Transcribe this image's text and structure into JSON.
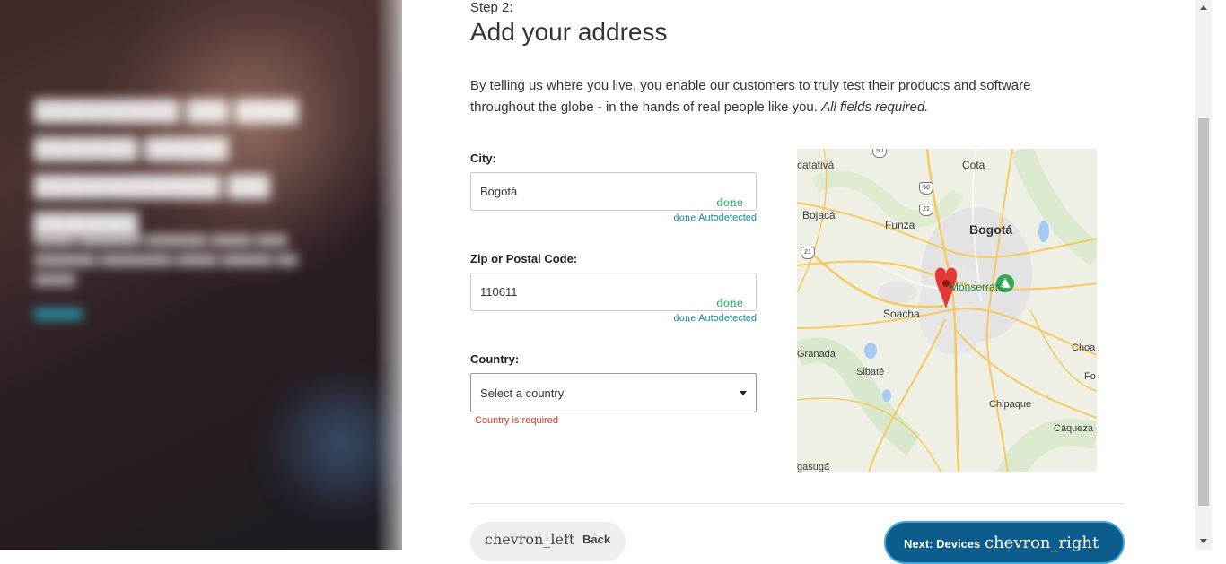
{
  "hero": {
    "blurred": true
  },
  "step": {
    "label": "Step 2:",
    "title": "Add your address"
  },
  "intro": {
    "text": "By telling us where you live, you enable our customers to truly test their products and software throughout the globe - in the hands of real people like you. ",
    "emphasis": "All fields required."
  },
  "form": {
    "city": {
      "label": "City:",
      "value": "Bogotá",
      "status_icon": "done",
      "autodetected_icon": "done",
      "autodetected": "Autodetected"
    },
    "zip": {
      "label": "Zip or Postal Code:",
      "value": "110611",
      "status_icon": "done",
      "autodetected_icon": "done",
      "autodetected": "Autodetected"
    },
    "country": {
      "label": "Country:",
      "placeholder": "Select a country",
      "error": "Country is required"
    }
  },
  "map": {
    "labels": {
      "catativa": "catativá",
      "cota": "Cota",
      "bojaca": "Bojacá",
      "funza": "Funza",
      "bogota": "Bogotá",
      "monserrate": "Monserrate",
      "soacha": "Soacha",
      "granada": "Granada",
      "sibate": "Sibaté",
      "choa": "Choa",
      "fo": "Fo",
      "chipaque": "Chipaque",
      "caqueza": "Cáqueza",
      "fusagasuga": "gasugá"
    },
    "shields": {
      "r50a": "50",
      "r50b": "50",
      "r21a": "21",
      "r21b": "21"
    }
  },
  "nav": {
    "back_icon": "chevron_left",
    "back_label": "Back",
    "next_label": "Next: Devices",
    "next_icon": "chevron_right"
  },
  "colors": {
    "accent": "#0c5c8e",
    "success": "#12b05a",
    "link": "#0b8fa3",
    "error": "#e0352b"
  }
}
